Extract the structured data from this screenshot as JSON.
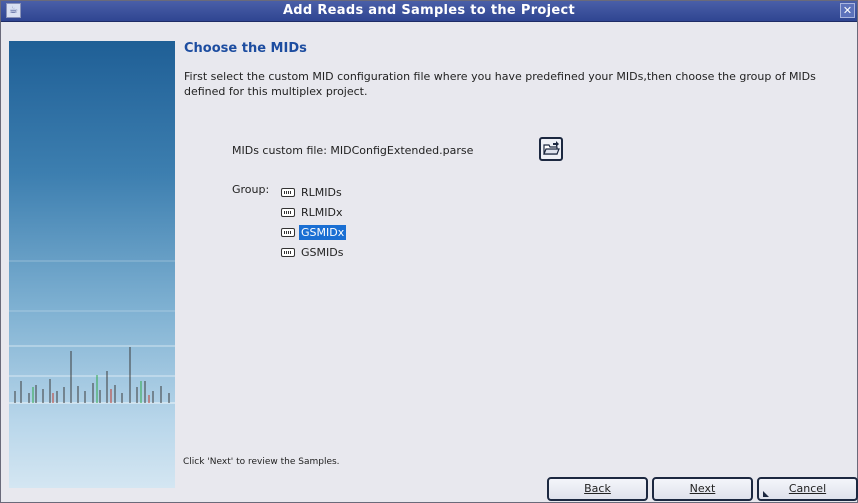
{
  "window": {
    "title": "Add Reads and Samples to the Project"
  },
  "page": {
    "heading": "Choose the MIDs",
    "description": "First select the custom MID configuration file where you have predefined your MIDs,then choose the group of MIDs defined for this multiplex project."
  },
  "mids": {
    "label": "MIDs custom file: MIDConfigExtended.parse",
    "open_icon": "folder-open-icon"
  },
  "group": {
    "label": "Group:",
    "items": [
      {
        "label": "RLMIDs",
        "selected": false
      },
      {
        "label": "RLMIDx",
        "selected": false
      },
      {
        "label": "GSMIDx",
        "selected": true
      },
      {
        "label": "GSMIDs",
        "selected": false
      }
    ]
  },
  "hint": "Click 'Next' to review the Samples.",
  "buttons": {
    "back": "Back",
    "next": "Next",
    "cancel": "Cancel"
  },
  "colors": {
    "title_bar": "#2f4591",
    "heading": "#1d4da0",
    "selection": "#1a6fd3"
  }
}
